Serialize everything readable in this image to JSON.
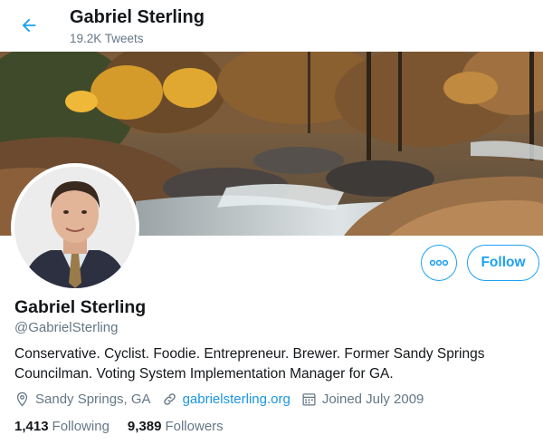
{
  "header": {
    "name": "Gabriel Sterling",
    "tweet_count": "19.2K Tweets"
  },
  "actions": {
    "follow_label": "Follow"
  },
  "profile": {
    "name": "Gabriel Sterling",
    "handle": "@GabrielSterling",
    "bio": "Conservative. Cyclist. Foodie. Entrepreneur. Brewer. Former Sandy Springs Councilman. Voting System Implementation Manager for GA.",
    "location": "Sandy Springs, GA",
    "website": "gabrielsterling.org",
    "joined": "Joined July 2009"
  },
  "stats": {
    "following_count": "1,413",
    "following_label": "Following",
    "followers_count": "9,389",
    "followers_label": "Followers"
  },
  "colors": {
    "accent": "#1da1f2",
    "secondary_text": "#657786",
    "primary_text": "#14171a"
  },
  "icons": {
    "back": "arrow-left-icon",
    "more": "more-dots-icon",
    "location": "location-pin-icon",
    "link": "link-icon",
    "calendar": "calendar-icon"
  }
}
